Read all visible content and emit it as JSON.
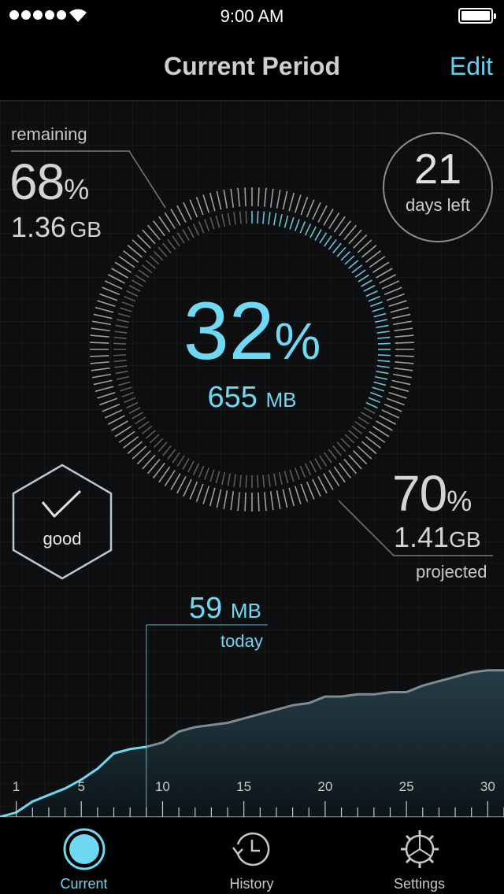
{
  "status_bar": {
    "time": "9:00 AM"
  },
  "nav": {
    "title": "Current Period",
    "edit_label": "Edit"
  },
  "remaining": {
    "label": "remaining",
    "percent": "68",
    "percent_sign": "%",
    "amount": "1.36",
    "unit": "GB"
  },
  "used": {
    "percent": "32",
    "percent_sign": "%",
    "amount": "655",
    "unit": "MB",
    "fraction": 0.32
  },
  "days": {
    "count": "21",
    "label": "days left"
  },
  "status": {
    "label": "good"
  },
  "projected": {
    "percent": "70",
    "percent_sign": "%",
    "amount": "1.41",
    "unit": "GB",
    "label": "projected"
  },
  "today": {
    "amount": "59",
    "unit": "MB",
    "label": "today",
    "day": 9
  },
  "colors": {
    "accent": "#6fd8f2",
    "background": "#000000",
    "text": "#d8d8d8"
  },
  "chart_data": {
    "type": "area",
    "x": [
      0,
      1,
      2,
      3,
      4,
      5,
      6,
      7,
      8,
      9,
      10,
      11,
      12,
      13,
      14,
      15,
      16,
      17,
      18,
      19,
      20,
      21,
      22,
      23,
      24,
      25,
      26,
      27,
      28,
      29,
      30,
      31
    ],
    "values": [
      0,
      2,
      7,
      10,
      13,
      17,
      22,
      29,
      31,
      32,
      34,
      39,
      41,
      42,
      43,
      45,
      47,
      49,
      51,
      52,
      55,
      55,
      56,
      56,
      57,
      57,
      60,
      62,
      64,
      66,
      67,
      67
    ],
    "tick_labels": [
      "1",
      "5",
      "10",
      "15",
      "20",
      "25",
      "30"
    ],
    "tick_values": [
      1,
      5,
      10,
      15,
      20,
      25,
      30
    ],
    "ylim": [
      0,
      100
    ]
  },
  "tabs": [
    {
      "label": "Current",
      "icon": "current-icon",
      "active": true
    },
    {
      "label": "History",
      "icon": "history-icon",
      "active": false
    },
    {
      "label": "Settings",
      "icon": "settings-icon",
      "active": false
    }
  ]
}
